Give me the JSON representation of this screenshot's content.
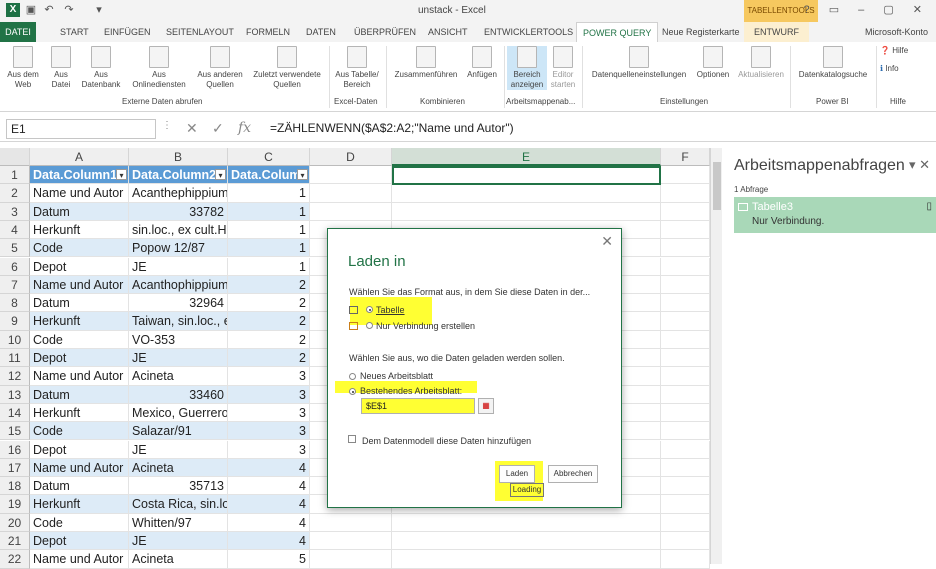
{
  "app": {
    "title": "unstack - Excel",
    "contextual_tab_group": "TABELLENTOOLS",
    "account": "Microsoft-Konto"
  },
  "ribbon_tabs": [
    "DATEI",
    "START",
    "EINFÜGEN",
    "SEITENLAYOUT",
    "FORMELN",
    "DATEN",
    "ÜBERPRÜFEN",
    "ANSICHT",
    "ENTWICKLERTOOLS",
    "POWER QUERY",
    "Neue Registerkarte",
    "ENTWURF"
  ],
  "active_tab": "POWER QUERY",
  "ribbon": {
    "buttons": {
      "aus_dem_web": "Aus dem\nWeb",
      "aus_datei": "Aus\nDatei",
      "aus_datenbank": "Aus\nDatenbank",
      "aus_onlinediensten": "Aus\nOnlinediensten",
      "aus_anderen_quellen": "Aus anderen\nQuellen",
      "zuletzt_verwendete": "Zuletzt verwendete\nQuellen",
      "aus_tabelle": "Aus Tabelle/\nBereich",
      "zusammenfuehren": "Zusammenführen",
      "anfuegen": "Anfügen",
      "bereich_anzeigen": "Bereich\nanzeigen",
      "editor_starten": "Editor\nstarten",
      "datenquelleneinstellungen": "Datenquelleneinstellungen",
      "optionen": "Optionen",
      "aktualisieren": "Aktualisieren",
      "datenkatalogsuche": "Datenkatalogsuche",
      "hilfe": "Hilfe",
      "info": "Info"
    },
    "groups": {
      "externe_daten": "Externe Daten abrufen",
      "excel_daten": "Excel-Daten",
      "kombinieren": "Kombinieren",
      "arbeitsmappenab": "Arbeitsmappenab...",
      "einstellungen": "Einstellungen",
      "power_bi": "Power BI",
      "hilfe": "Hilfe"
    }
  },
  "formula_bar": {
    "name_box": "E1",
    "formula": "=ZÄHLENWENN($A$2:A2;\"Name und Autor\")"
  },
  "columns": [
    "A",
    "B",
    "C",
    "D",
    "E",
    "F"
  ],
  "selected_column": "E",
  "table": {
    "headers": [
      "Data.Column1",
      "Data.Column2",
      "Data.Colum"
    ],
    "rows": [
      [
        "Name und Autor",
        "Acanthephippium",
        "1"
      ],
      [
        "Datum",
        "33782",
        "1"
      ],
      [
        "Herkunft",
        "sin.loc., ex cult.H",
        "1"
      ],
      [
        "Code",
        "Popow 12/87",
        "1"
      ],
      [
        "Depot",
        "JE",
        "1"
      ],
      [
        "Name und Autor",
        "Acanthophippium",
        "2"
      ],
      [
        "Datum",
        "32964",
        "2"
      ],
      [
        "Herkunft",
        "Taiwan, sin.loc., e",
        "2"
      ],
      [
        "Code",
        "VO-353",
        "2"
      ],
      [
        "Depot",
        "JE",
        "2"
      ],
      [
        "Name und Autor",
        "Acineta",
        "3"
      ],
      [
        "Datum",
        "33460",
        "3"
      ],
      [
        "Herkunft",
        "Mexico, Guerrero",
        "3"
      ],
      [
        "Code",
        "Salazar/91",
        "3"
      ],
      [
        "Depot",
        "JE",
        "3"
      ],
      [
        "Name und Autor",
        "Acineta",
        "4"
      ],
      [
        "Datum",
        "35713",
        "4"
      ],
      [
        "Herkunft",
        "Costa Rica, sin.loc",
        "4"
      ],
      [
        "Code",
        "Whitten/97",
        "4"
      ],
      [
        "Depot",
        "JE",
        "4"
      ],
      [
        "Name und Autor",
        "Acineta",
        "5"
      ]
    ]
  },
  "row_numbers": [
    "1",
    "2",
    "3",
    "4",
    "5",
    "6",
    "7",
    "8",
    "9",
    "10",
    "11",
    "12",
    "13",
    "14",
    "15",
    "16",
    "17",
    "18",
    "19",
    "20",
    "21",
    "22"
  ],
  "pane": {
    "title": "Arbeitsmappenabfragen",
    "count": "1 Abfrage",
    "query_name": "Tabelle3",
    "query_status": "Nur Verbindung."
  },
  "dialog": {
    "title": "Laden in",
    "prompt_format": "Wählen Sie das Format aus, in dem Sie diese Daten in der...",
    "opt_tabelle": "Tabelle",
    "opt_verbindung": "Nur Verbindung erstellen",
    "prompt_location": "Wählen Sie aus, wo die Daten geladen werden sollen.",
    "opt_neues": "Neues Arbeitsblatt",
    "opt_bestehendes": "Bestehendes Arbeitsblatt:",
    "range_value": "$E$1",
    "datenmodell": "Dem Datenmodell diese Daten hinzufügen",
    "laden": "Laden",
    "abbrechen": "Abbrechen",
    "tooltip": "Loading"
  },
  "colors": {
    "excel_green": "#217346",
    "table_header": "#5b9bd5",
    "table_band": "#ddebf7",
    "highlight": "#ffff33"
  }
}
